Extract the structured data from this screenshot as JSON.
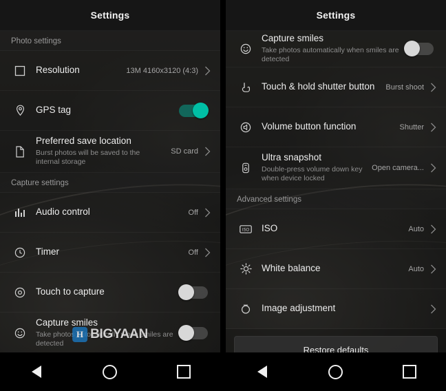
{
  "left_screen": {
    "title": "Settings",
    "sections": [
      {
        "header": "Photo settings"
      },
      {
        "header": "Capture settings"
      }
    ],
    "photo_settings_header": "Photo settings",
    "capture_settings_header": "Capture settings",
    "rows": [
      {
        "icon": "square-resolution-icon",
        "label": "Resolution",
        "sub": "",
        "value": "13M 4160x3120 (4:3)",
        "control": "chevron"
      },
      {
        "icon": "location-pin-icon",
        "label": "GPS tag",
        "sub": "",
        "value": "",
        "control": "toggle-on"
      },
      {
        "icon": "file-icon",
        "label": "Preferred save location",
        "sub": "Burst photos will be saved to the internal storage",
        "value": "SD card",
        "control": "chevron"
      },
      {
        "icon": "audio-levels-icon",
        "label": "Audio control",
        "sub": "",
        "value": "Off",
        "control": "chevron"
      },
      {
        "icon": "clock-timer-icon",
        "label": "Timer",
        "sub": "",
        "value": "Off",
        "control": "chevron"
      },
      {
        "icon": "touch-capture-icon",
        "label": "Touch to capture",
        "sub": "",
        "value": "",
        "control": "toggle-off"
      },
      {
        "icon": "smile-face-icon",
        "label": "Capture smiles",
        "sub": "Take photos automatically when smiles are detected",
        "value": "",
        "control": "toggle-off"
      }
    ]
  },
  "right_screen": {
    "title": "Settings",
    "advanced_settings_header": "Advanced settings",
    "rows": [
      {
        "icon": "smile-face-icon",
        "label": "Capture smiles",
        "sub": "Take photos automatically when smiles are detected",
        "value": "",
        "control": "toggle-off"
      },
      {
        "icon": "touch-hold-shutter-icon",
        "label": "Touch & hold shutter button",
        "sub": "",
        "value": "Burst shoot",
        "control": "chevron"
      },
      {
        "icon": "volume-button-icon",
        "label": "Volume button function",
        "sub": "",
        "value": "Shutter",
        "control": "chevron"
      },
      {
        "icon": "ultra-snapshot-icon",
        "label": "Ultra snapshot",
        "sub": "Double-press volume down key when device locked",
        "value": "Open camera...",
        "control": "chevron"
      },
      {
        "icon": "iso-icon",
        "label": "ISO",
        "sub": "",
        "value": "Auto",
        "control": "chevron"
      },
      {
        "icon": "white-balance-icon",
        "label": "White balance",
        "sub": "",
        "value": "Auto",
        "control": "chevron"
      },
      {
        "icon": "image-adjustment-icon",
        "label": "Image adjustment",
        "sub": "",
        "value": "",
        "control": "chevron"
      }
    ],
    "restore_defaults_label": "Restore defaults"
  },
  "navbar": {
    "back_label": "Back",
    "home_label": "Home",
    "recents_label": "Recents"
  },
  "watermark": {
    "badge": "H",
    "text": "BIGYAAN"
  },
  "colors": {
    "accent_on": "#00bfa5",
    "toggle_off_knob": "#d8d8d8",
    "watermark_badge": "#1b75bb",
    "background": "#1a1a18"
  }
}
